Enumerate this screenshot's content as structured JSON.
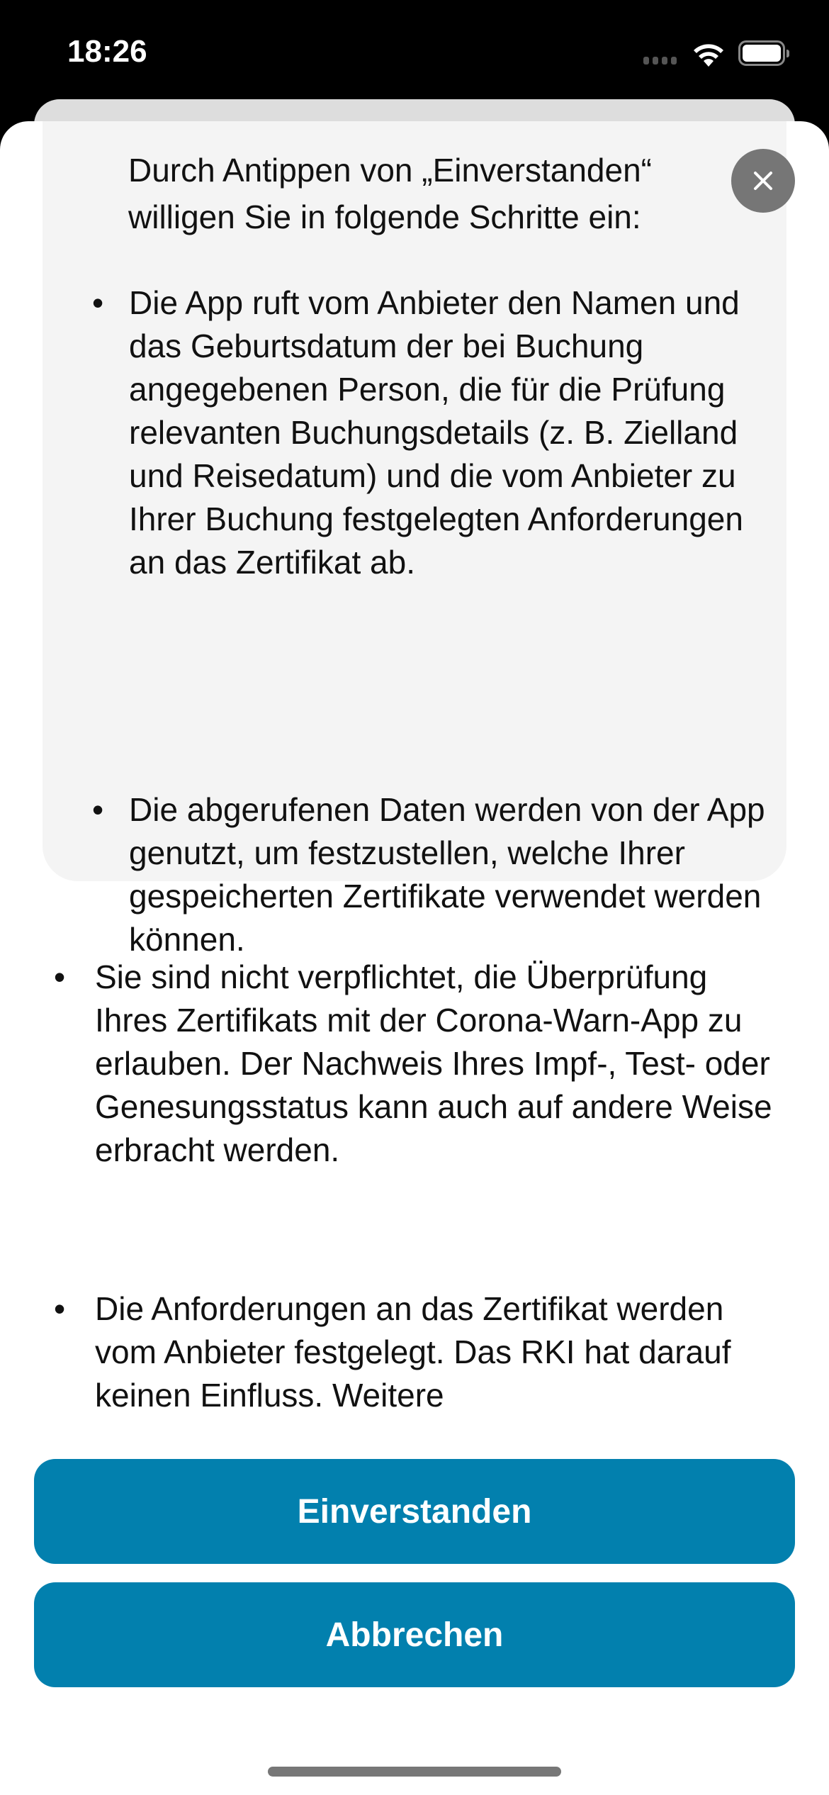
{
  "status_bar": {
    "time": "18:26"
  },
  "sheet": {
    "intro": "Durch Antippen von „Einverstanden“ willigen Sie in folgende Schritte ein:",
    "consent_steps": [
      "Die App ruft vom Anbieter den Namen und das Geburtsdatum der bei Buchung angegebenen Person, die für die Prüfung relevanten Buchungsdetails (z. B. Zielland und Reisedatum) und die vom Anbieter zu Ihrer Buchung festgelegten Anforderungen an das Zertifikat ab.",
      "Die abgerufenen Daten werden von der App genutzt, um festzustellen, welche Ihrer gespeicherten Zertifikate verwendet werden können."
    ],
    "notes": [
      "Sie sind nicht verpflichtet, die Überprüfung Ihres Zertifikats mit der Corona-Warn-App zu erlauben. Der Nachweis Ihres Impf-, Test- oder Genesungsstatus kann auch auf andere Weise erbracht werden.",
      "Die Anforderungen an das Zertifikat werden vom Anbieter festgelegt. Das RKI hat darauf keinen Einfluss. Weitere"
    ],
    "bullet": "•",
    "accept_label": "Einverstanden",
    "cancel_label": "Abbrechen"
  },
  "colors": {
    "primary": "#0280ae",
    "box": "#f4f4f4",
    "close": "#767676"
  }
}
